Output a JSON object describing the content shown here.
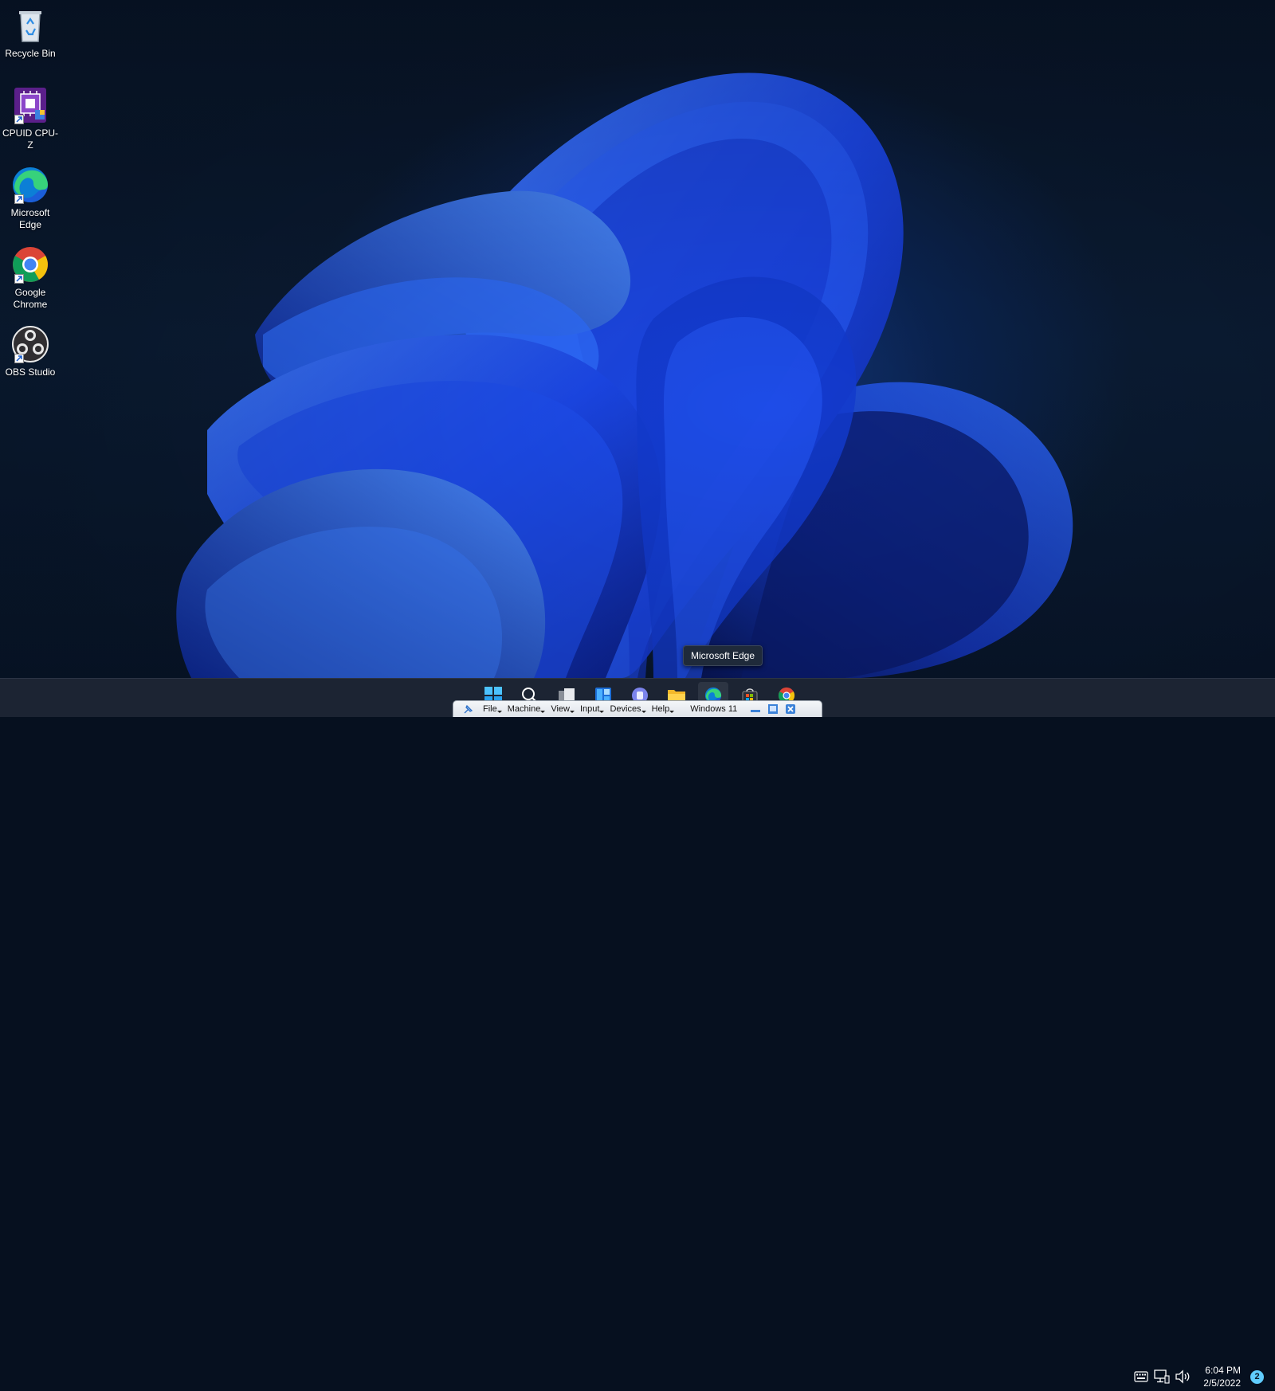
{
  "desktop": {
    "icons": [
      {
        "label": "Recycle Bin",
        "icon": "recycle-bin-icon"
      },
      {
        "label": "CPUID CPU-Z",
        "icon": "cpu-z-icon"
      },
      {
        "label": "Microsoft\nEdge",
        "icon": "edge-icon"
      },
      {
        "label": "Google\nChrome",
        "icon": "chrome-icon"
      },
      {
        "label": "OBS Studio",
        "icon": "obs-icon"
      }
    ]
  },
  "tooltip": {
    "text": "Microsoft Edge"
  },
  "taskbar": {
    "apps": [
      "start-icon",
      "search-icon",
      "task-view-icon",
      "widgets-icon",
      "teams-chat-icon",
      "file-explorer-icon",
      "edge-icon",
      "store-icon",
      "chrome-icon"
    ],
    "active_app": "edge-icon"
  },
  "vbox_toolbar": {
    "menus": [
      "File",
      "Machine",
      "View",
      "Input",
      "Devices",
      "Help"
    ],
    "vm_name": "Windows 11"
  },
  "tray": {
    "time": "6:04 PM",
    "date": "2/5/2022",
    "notification_count": "2"
  },
  "colors": {
    "accent": "#60cdff",
    "taskbar": "#1c2433",
    "bloom": "#1a4cff"
  }
}
